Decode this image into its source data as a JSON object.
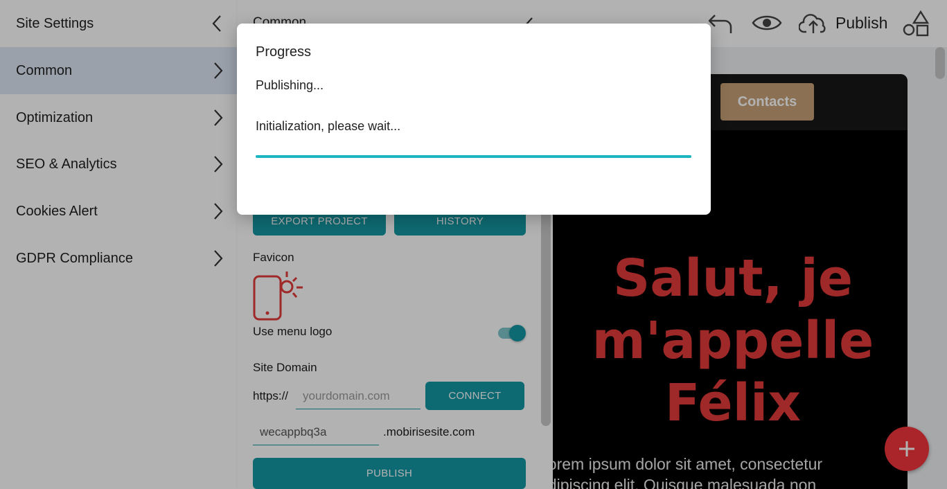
{
  "sidebar": {
    "items": [
      {
        "label": "Site Settings",
        "chevron": "chevron-left-icon"
      },
      {
        "label": "Common",
        "chevron": "chevron-right-icon"
      },
      {
        "label": "Optimization",
        "chevron": "chevron-right-icon"
      },
      {
        "label": "SEO & Analytics",
        "chevron": "chevron-right-icon"
      },
      {
        "label": "Cookies Alert",
        "chevron": "chevron-right-icon"
      },
      {
        "label": "GDPR Compliance",
        "chevron": "chevron-right-icon"
      }
    ]
  },
  "panel": {
    "title": "Common",
    "export_label": "EXPORT PROJECT",
    "history_label": "HISTORY",
    "favicon_label": "Favicon",
    "use_menu_logo_label": "Use menu logo",
    "use_menu_logo_on": true,
    "site_domain_label": "Site Domain",
    "https_prefix": "https://",
    "domain_placeholder": "yourdomain.com",
    "connect_label": "CONNECT",
    "subdomain_value": "wecappbq3a",
    "subdomain_suffix": ".mobirisesite.com",
    "publish_label": "PUBLISH"
  },
  "topbar": {
    "publish_label": "Publish",
    "icons": [
      "undo-icon",
      "eye-icon",
      "cloud-upload-icon",
      "blocks-icon"
    ]
  },
  "preview": {
    "contacts_label": "Contacts",
    "hero_line1": "Salut, je",
    "hero_line2": "m'appelle",
    "hero_line3": "Félix",
    "hero_text_line1": "Lorem ipsum dolor sit amet, consectetur",
    "hero_text_line2": "adipiscing elit. Quisque malesuada non"
  },
  "dialog": {
    "title": "Progress",
    "status": "Publishing...",
    "detail": "Initialization, please wait...",
    "progress": 1.0
  },
  "colors": {
    "accent": "#1598a4",
    "progress": "#1db5c0",
    "hero": "#e43a3a",
    "fab": "#f4353b",
    "contacts_button": "#c7a178"
  }
}
